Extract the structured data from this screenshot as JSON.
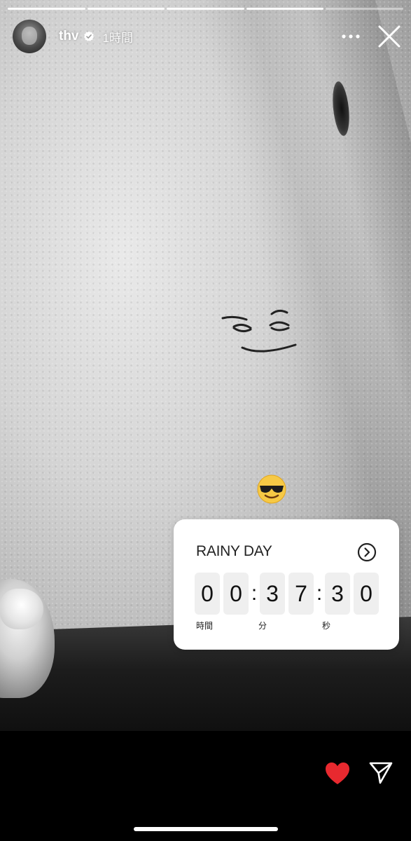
{
  "progress": {
    "segments": 5,
    "current_index": 4
  },
  "header": {
    "username": "thv",
    "time_ago": "1時間",
    "avatar_icon": "avatar-photo",
    "verified_icon": "verified-badge-icon",
    "more_icon": "more-horizontal-icon",
    "close_icon": "close-icon"
  },
  "story": {
    "stickers": [
      "smiling-face-with-sunglasses-emoji"
    ]
  },
  "countdown": {
    "title": "RAINY DAY",
    "go_icon": "chevron-right-circle-icon",
    "digits": [
      "0",
      "0",
      "3",
      "7",
      "3",
      "0"
    ],
    "separator": ":",
    "units": {
      "hours": "時間",
      "minutes": "分",
      "seconds": "秒"
    }
  },
  "actions": {
    "like_icon": "heart-icon",
    "like_color": "#e8292f",
    "send_icon": "send-icon"
  }
}
